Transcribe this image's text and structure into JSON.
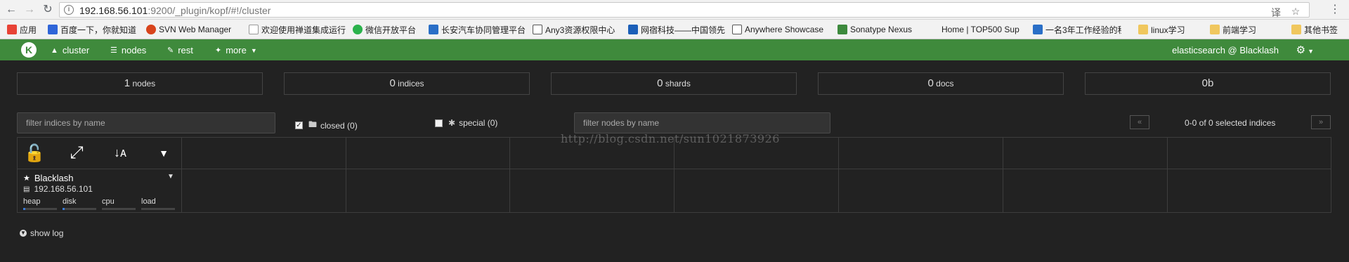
{
  "browser": {
    "url_host": "192.168.56.101",
    "url_rest": ":9200/_plugin/kopf/#!/cluster",
    "back_icon": "back-arrow-icon",
    "forward_icon": "forward-arrow-icon",
    "reload_icon": "reload-icon",
    "info_glyph": "i"
  },
  "bookmarks": [
    {
      "label": "应用",
      "color": "#e84336"
    },
    {
      "label": "百度一下，你就知道",
      "color": "#2f65d8"
    },
    {
      "label": "SVN Web Manager",
      "color": "#d8441c"
    },
    {
      "label": "欢迎使用禅道集成运行",
      "color": "#999999"
    },
    {
      "label": "微信开放平台",
      "color": "#2bb24c"
    },
    {
      "label": "长安汽车协同管理平台",
      "color": "#2a6fc7"
    },
    {
      "label": "Any3资源权限中心",
      "color": "#555555"
    },
    {
      "label": "网宿科技——中国领先",
      "color": "#1b5fb8"
    },
    {
      "label": "Anywhere Showcase",
      "color": "#555555"
    },
    {
      "label": "Sonatype Nexus",
      "color": "#3d8a3d"
    },
    {
      "label": "Home | TOP500 Sup",
      "color": "#f2f2f2"
    },
    {
      "label": "一名3年工作经验的程",
      "color": "#2a6fc7"
    },
    {
      "label": "linux学习",
      "color": "#f0c75e"
    },
    {
      "label": "前端学习",
      "color": "#f0c75e"
    },
    {
      "label": "其他书签",
      "color": "#f0c75e"
    }
  ],
  "navbar": {
    "logo": "K",
    "cluster": "cluster",
    "nodes": "nodes",
    "rest": "rest",
    "more": "more",
    "cluster_name": "elasticsearch @ Blacklash"
  },
  "stats": [
    {
      "num": "1",
      "label": "nodes"
    },
    {
      "num": "0",
      "label": "indices"
    },
    {
      "num": "0",
      "label": "shards"
    },
    {
      "num": "0",
      "label": "docs"
    },
    {
      "num": "0b",
      "label": ""
    }
  ],
  "filters": {
    "indices_placeholder": "filter indices by name",
    "nodes_placeholder": "filter nodes by name",
    "closed_label": "closed (0)",
    "closed_checked": true,
    "special_label": "special (0)",
    "special_checked": false
  },
  "pager": {
    "prev": "«",
    "next": "»",
    "text": "0-0 of 0 selected indices"
  },
  "node": {
    "name": "Blacklash",
    "ip": "192.168.56.101",
    "metrics": [
      {
        "label": "heap",
        "fill": 0.06
      },
      {
        "label": "disk",
        "fill": 0.06
      },
      {
        "label": "cpu",
        "fill": 0
      },
      {
        "label": "load",
        "fill": 0
      }
    ]
  },
  "footer": {
    "show_log": "show log"
  },
  "watermark": "http://blog.csdn.net/sun1021873926"
}
